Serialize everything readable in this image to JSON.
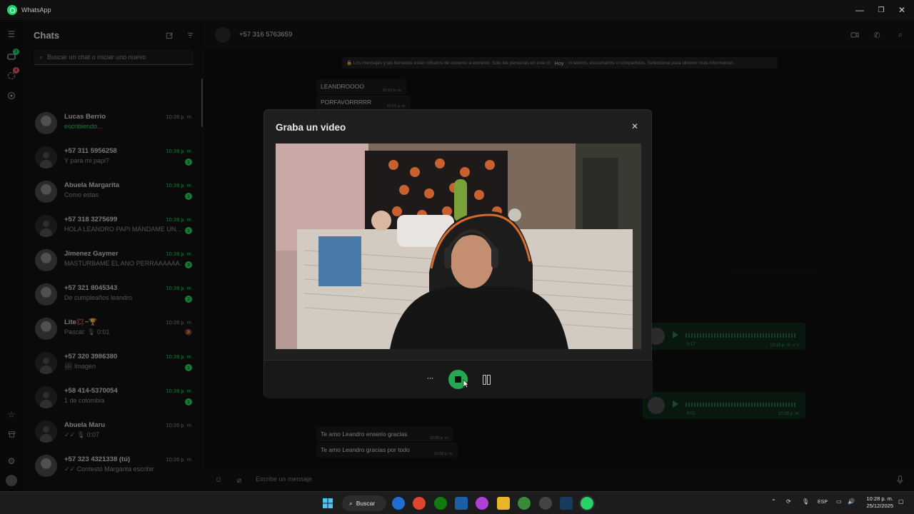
{
  "app": {
    "title": "WhatsApp"
  },
  "window_controls": {
    "minimize": "—",
    "maximize": "❐",
    "close": "✕"
  },
  "rail": {
    "chats_badge": "3",
    "status_badge": "4"
  },
  "sidebar": {
    "title": "Chats",
    "search_placeholder": "Buscar un chat o iniciar uno nuevo",
    "chats": [
      {
        "name": "Lucas Berrio",
        "preview": "escribiendo...",
        "time": "10:28 p. m.",
        "typing": true,
        "badge": "",
        "new": false,
        "avatar": "photo"
      },
      {
        "name": "+57 311 5956258",
        "preview": "Y para mi papi?",
        "time": "10:28 p. m.",
        "badge": "1",
        "new": true,
        "avatar": "blank"
      },
      {
        "name": "Abuela Margarita",
        "preview": "Como estas",
        "time": "10:28 p. m.",
        "badge": "1",
        "new": true,
        "avatar": "photo"
      },
      {
        "name": "+57 318 3275699",
        "preview": "HOLA LEANDRO PAPI MÁNDAME UN...",
        "time": "10:28 p. m.",
        "badge": "1",
        "new": true,
        "avatar": "blank"
      },
      {
        "name": "Jimenez Gaymer",
        "preview": "MASTURBAME EL ANO PERRAAAAAA...",
        "time": "10:28 p. m.",
        "badge": "3",
        "new": true,
        "avatar": "photo"
      },
      {
        "name": "+57 321 8045343",
        "preview": "De cumpleaños leandro",
        "time": "10:28 p. m.",
        "badge": "2",
        "new": true,
        "avatar": "photo"
      },
      {
        "name": "Lite💢~🏆",
        "preview": "Pascal: 🎙 0:01",
        "time": "10:28 p. m.",
        "badge": "",
        "new": false,
        "muted": true,
        "avatar": "photo"
      },
      {
        "name": "+57 320 3986380",
        "preview": "🖼 Imagen",
        "time": "10:28 p. m.",
        "badge": "1",
        "new": true,
        "avatar": "blank"
      },
      {
        "name": "+58 414-5370054",
        "preview": "1 de colombia",
        "time": "10:28 p. m.",
        "badge": "1",
        "new": true,
        "avatar": "blank"
      },
      {
        "name": "Abuela Maru",
        "preview": "✓✓ 🎙 0:07",
        "time": "10:26 p. m.",
        "badge": "",
        "new": false,
        "avatar": "blank"
      },
      {
        "name": "+57 323 4321338 (tú)",
        "preview": "✓✓ Contestó Margarita escribir",
        "time": "10:26 p. m.",
        "badge": "",
        "new": false,
        "avatar": "photo"
      }
    ]
  },
  "conversation": {
    "contact": "+57 316 5763659",
    "notice": "🔒 Los mensajes y las llamadas están cifrados de extremo a extremo. Solo las personas en este chat pueden leerlos, escucharlos o compartirlos. Selecciona para obtener más información.",
    "date_chip": "Hoy",
    "messages": [
      {
        "text": "LEANDROOOO",
        "time": "10:15 p. m."
      },
      {
        "text": "PORFAVORRRRR",
        "time": "10:15 p. m."
      },
      {
        "text": "Te amo Leandro enserio gracias",
        "time": "10:28 p. m."
      },
      {
        "text": "Te amo Leandro gracias por todo",
        "time": "10:28 p. m."
      }
    ],
    "voice_notes": [
      {
        "duration": "0:17",
        "time": "10:19 p. m. ✓✓"
      },
      {
        "duration": "0:02",
        "time": "10:28 p. m."
      }
    ],
    "composer_placeholder": "Escribe un mensaje"
  },
  "modal": {
    "title": "Graba un video",
    "close": "✕",
    "more": "···"
  },
  "taskbar": {
    "search_label": "Buscar",
    "lang": "ESP",
    "time": "10:28 p. m.",
    "date": "25/12/2025"
  },
  "colors": {
    "accent": "#25d366",
    "panel": "#121212",
    "modal": "#1f1f1f"
  }
}
